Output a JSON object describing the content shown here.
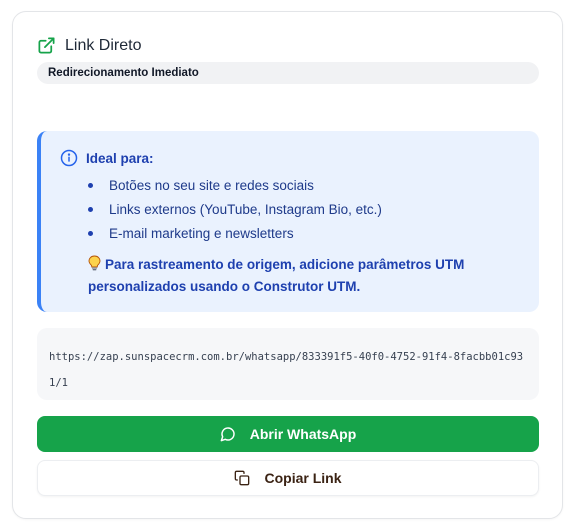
{
  "header": {
    "icon": "external-link-icon",
    "title": "Link Direto",
    "subtitle": "Redirecionamento Imediato",
    "accent": "#16a34a"
  },
  "info": {
    "icon": "info-icon",
    "title": "Ideal para:",
    "items": [
      "Botões no seu site e redes sociais",
      "Links externos (YouTube, Instagram Bio, etc.)",
      "E-mail marketing e newsletters"
    ],
    "tip_icon": "lightbulb-icon",
    "tip": "Para rastreamento de origem, adicione parâmetros UTM personalizados usando o Construtor UTM.",
    "accent": "#3b82f6"
  },
  "url": {
    "value": "https://zap.sunspacecrm.com.br/whatsapp/833391f5-40f0-4752-91f4-8facbb01c931/1"
  },
  "actions": {
    "whatsapp_icon": "chat-bubble-icon",
    "whatsapp_label": "Abrir WhatsApp",
    "whatsapp_color": "#16a34a",
    "copy_icon": "copy-icon",
    "copy_label": "Copiar Link"
  }
}
